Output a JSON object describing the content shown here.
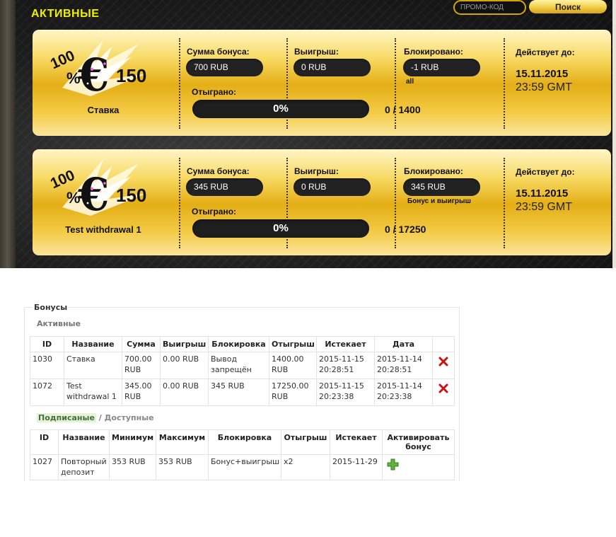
{
  "header": {
    "section_title": "АКТИВНЫЕ",
    "promo_placeholder": "ПРОМО-КОД",
    "search_label": "Поиск"
  },
  "logo": {
    "percent": "100",
    "percent_sign": "%",
    "currency": "€",
    "amount": "150"
  },
  "card_labels": {
    "bonus_amount": "Сумма бонуса:",
    "winnings": "Выигрыш:",
    "blocked": "Блокировано:",
    "valid_until": "Действует до:",
    "wagered": "Отыграно:"
  },
  "cards": [
    {
      "name": "Ставка",
      "bonus_amount": "700 RUB",
      "winnings": "0 RUB",
      "blocked": "-1 RUB",
      "blocked_note": "all",
      "progress_text": "0%",
      "progress_fraction": 0,
      "wager_count": "0 / 1400",
      "valid_date": "15.11.2015",
      "valid_time": "23:59 GMT"
    },
    {
      "name": "Test withdrawal 1",
      "bonus_amount": "345 RUB",
      "winnings": "0 RUB",
      "blocked": "345 RUB",
      "blocked_note": "Бонус и выигрыш",
      "progress_text": "0%",
      "progress_fraction": 0,
      "wager_count": "0 / 17250",
      "valid_date": "15.11.2015",
      "valid_time": "23:59 GMT"
    }
  ],
  "admin": {
    "legend": "Бонусы",
    "active_heading": "Активные",
    "active_columns": [
      "ID",
      "Название",
      "Сумма",
      "Выигрыш",
      "Блокировка",
      "Отыгрыш",
      "Истекает",
      "Дата"
    ],
    "active_rows": [
      [
        "1030",
        "Ставка",
        "700.00 RUB",
        "0.00 RUB",
        "Вывод запрещён",
        "1400.00 RUB",
        "2015-11-15 20:28:51",
        "2015-11-14 20:28:51"
      ],
      [
        "1072",
        "Test withdrawal 1",
        "345.00 RUB",
        "0.00 RUB",
        "345 RUB",
        "17250.00 RUB",
        "2015-11-15 20:23:38",
        "2015-11-14 20:23:38"
      ]
    ],
    "tab_subscribed": "Подписаные",
    "tab_separator": " / ",
    "tab_available": "Доступные",
    "available_columns": [
      "ID",
      "Название",
      "Минимум",
      "Максимум",
      "Блокировка",
      "Отыгрыш",
      "Истекает",
      "Активировать бонус"
    ],
    "available_rows": [
      [
        "1027",
        "Повторный депозит",
        "353 RUB",
        "353 RUB",
        "Бонус+выигрыш",
        "x2",
        "2015-11-29"
      ]
    ]
  },
  "colors": {
    "title_yellow": "#f0f000",
    "gold": "#e4ae16",
    "delete_red": "#cc1111",
    "add_green": "#4a9a2a"
  }
}
